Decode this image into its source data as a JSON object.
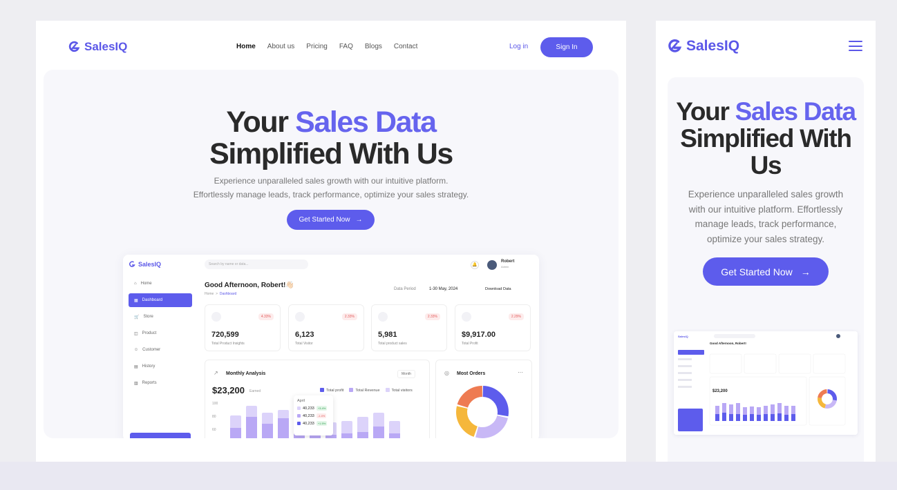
{
  "brand": {
    "name": "SalesIQ",
    "accent": "#5d5cec"
  },
  "nav": {
    "items": [
      "Home",
      "About us",
      "Pricing",
      "FAQ",
      "Blogs",
      "Contact"
    ],
    "login": "Log in",
    "signin": "Sign In"
  },
  "hero": {
    "title_part1": "Your ",
    "title_accent": "Sales Data",
    "title_line2": "Simplified  With Us",
    "subtitle": "Experience unparalleled sales growth with our intuitive platform. Effortlessly manage leads, track performance, optimize your sales strategy.",
    "cta": "Get Started Now"
  },
  "mobile": {
    "title_line2": "Simplified  With",
    "title_line3": "Us"
  },
  "dashboard": {
    "brand": "SalesIQ",
    "search_placeholder": "Search by name or data...",
    "user_name": "Robert",
    "user_role": "Admin",
    "greeting": "Good Afternoon, Robert!👋🏻",
    "breadcrumb_home": "Home",
    "breadcrumb_current": "Dashboard",
    "period_label": "Data Period",
    "period_value": "1-30 May, 2024",
    "download": "Download Data",
    "sidebar": [
      "Home",
      "Dashboard",
      "Store",
      "Product",
      "Customer",
      "History",
      "Reports"
    ],
    "cards": [
      {
        "value": "720,599",
        "label": "Total Product Insights",
        "change": "4.33%"
      },
      {
        "value": "6,123",
        "label": "Total Visitor",
        "change": "2.33%"
      },
      {
        "value": "5,981",
        "label": "Total product sales",
        "change": "2.33%"
      },
      {
        "value": "$9,917.00",
        "label": "Total Profit",
        "change": "2.29%"
      }
    ],
    "monthly": {
      "title": "Monthly Analysis",
      "range": "Month",
      "total": "$23,200",
      "total_label": "Earned",
      "legend": [
        "Total profit",
        "Total Revenue",
        "Total visitors"
      ],
      "yticks": [
        "100",
        "80",
        "60"
      ],
      "tooltip": {
        "month": "April",
        "rows": [
          {
            "value": "40,233",
            "change": "+3.4%"
          },
          {
            "value": "40,233",
            "change": "-1.4%"
          },
          {
            "value": "40,233",
            "change": "+1.5%"
          }
        ]
      }
    },
    "orders": {
      "title": "Most Orders"
    }
  }
}
